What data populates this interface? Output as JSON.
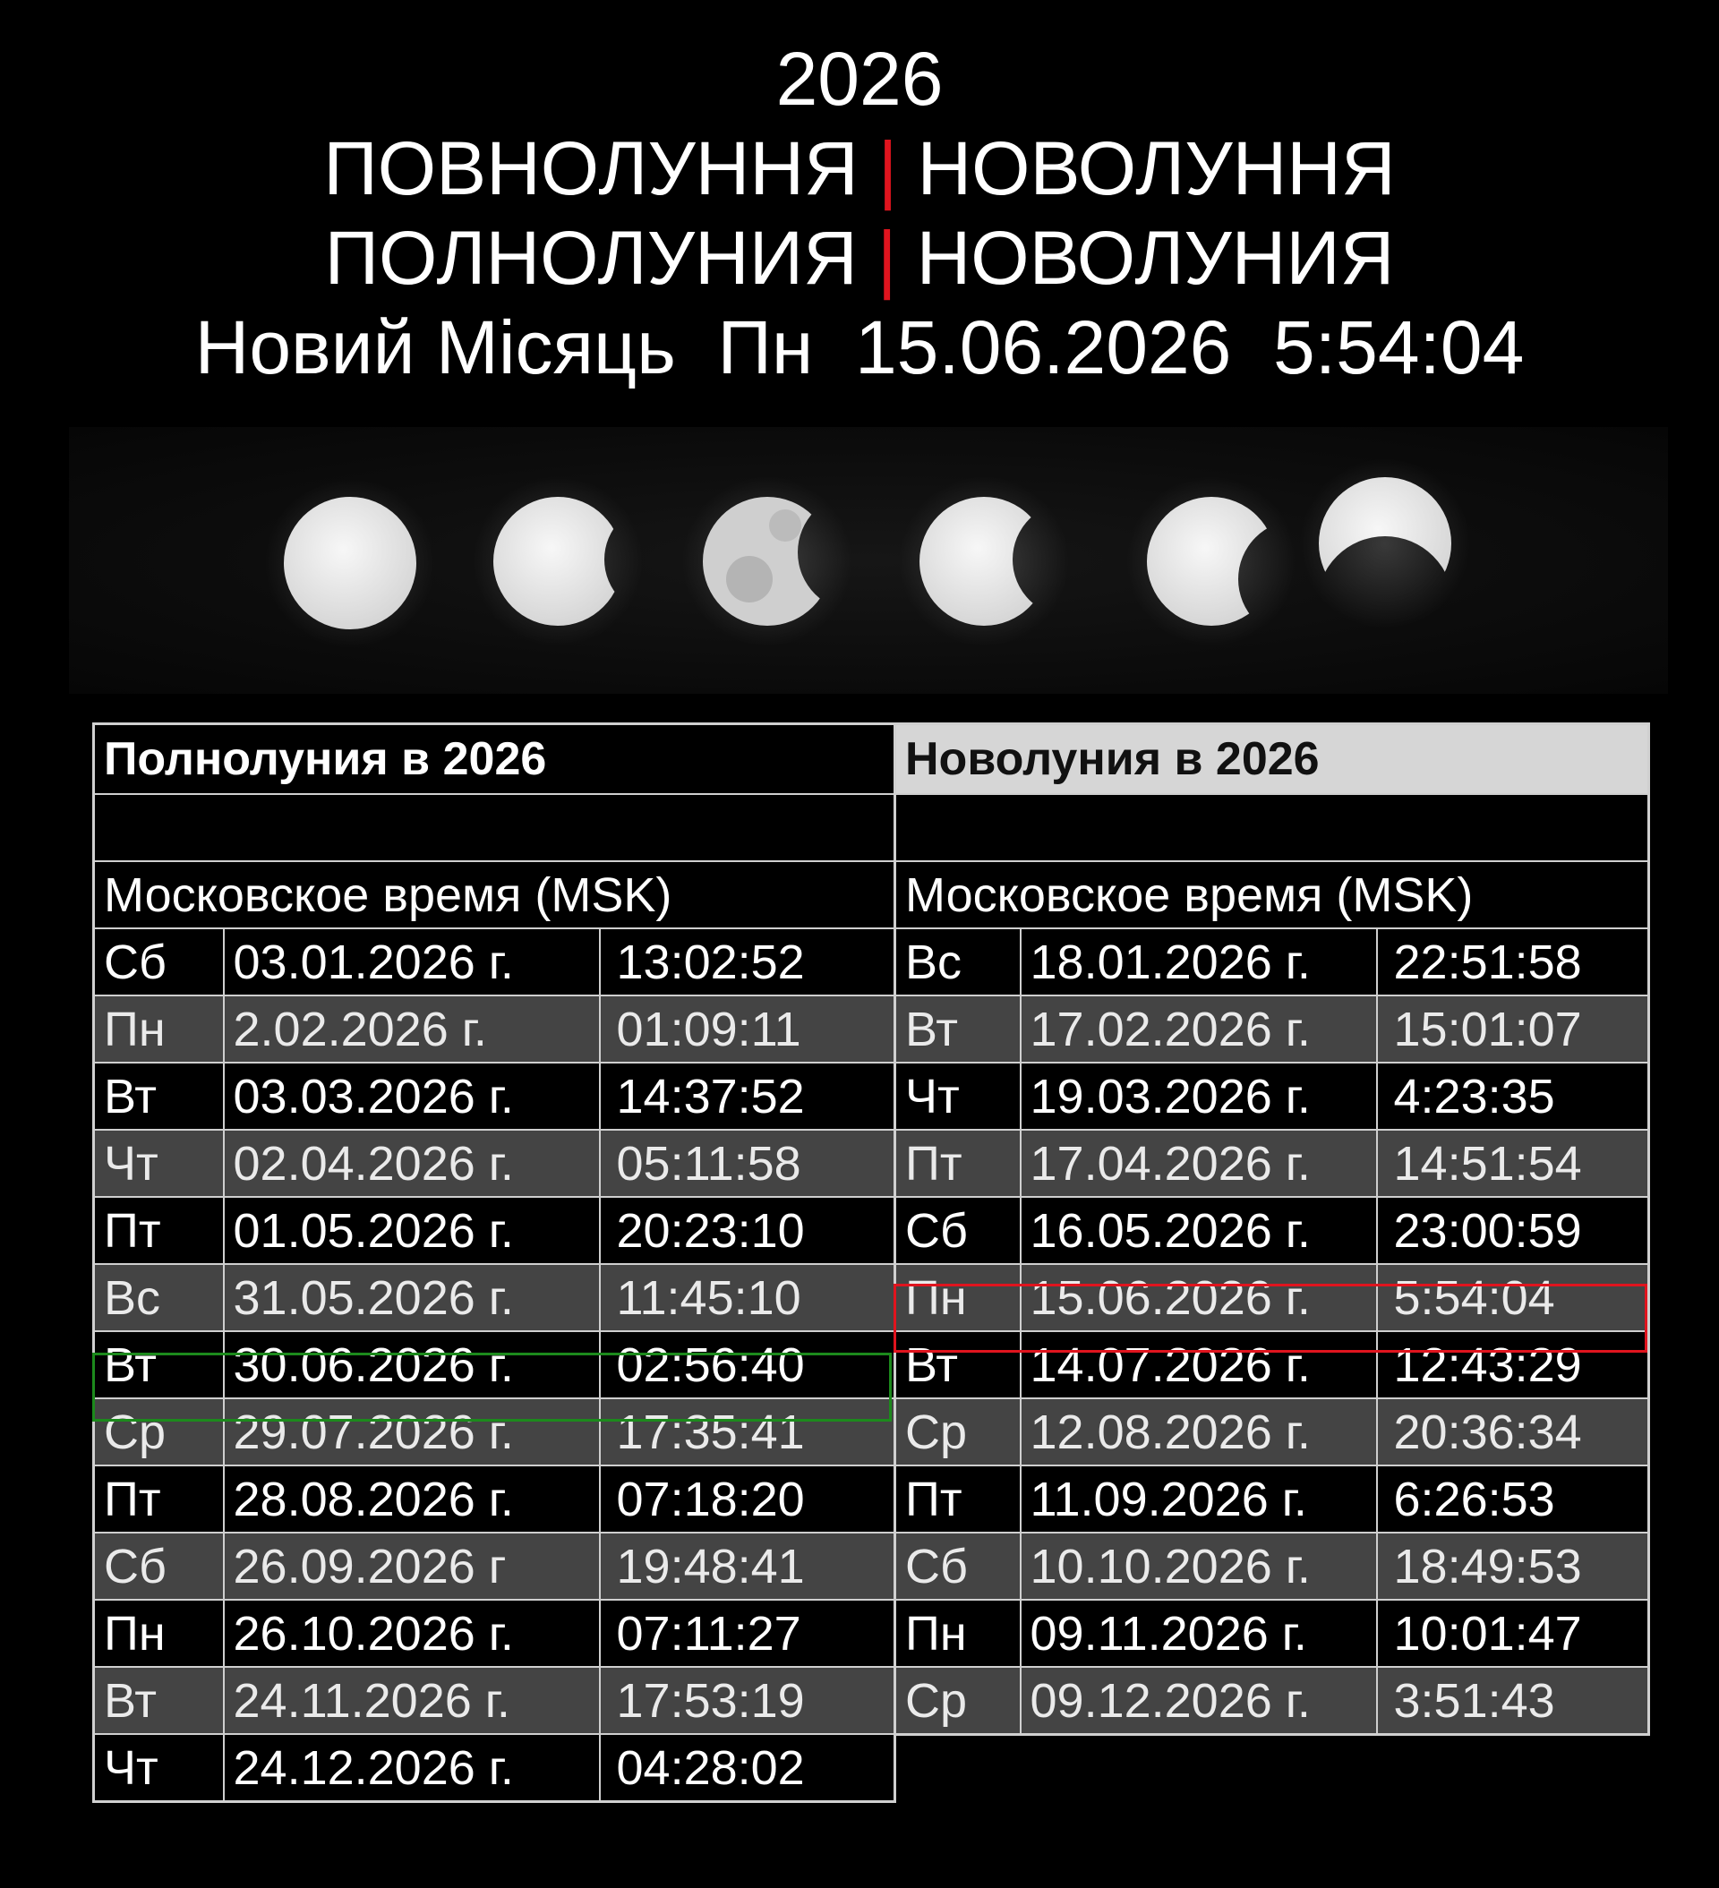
{
  "header": {
    "year": "2026",
    "line_uk_full": "ПОВНОЛУННЯ",
    "line_uk_new": "НОВОЛУННЯ",
    "line_ru_full": "ПОЛНОЛУНИЯ",
    "line_ru_new": "НОВОЛУНИЯ",
    "separator": "|",
    "event_label": "Новий Місяць  Пн  15.06.2026  5:54:04",
    "separator_color": "#e0141e"
  },
  "phases_image": {
    "icon": "moon-phases-strip",
    "count": 6
  },
  "full_moons": {
    "title": "Полнолуния в 2026",
    "blank": "",
    "timezone": "Московское время (MSK)",
    "rows": [
      [
        "Сб",
        "03.01.2026 г.",
        "13:02:52"
      ],
      [
        "Пн",
        "2.02.2026 г.",
        "01:09:11"
      ],
      [
        "Вт",
        "03.03.2026 г.",
        "14:37:52"
      ],
      [
        "Чт",
        "02.04.2026 г.",
        "05:11:58"
      ],
      [
        "Пт",
        "01.05.2026 г.",
        "20:23:10"
      ],
      [
        "Вс",
        "31.05.2026 г.",
        "11:45:10"
      ],
      [
        "Вт",
        "30.06.2026 г.",
        "02:56:40"
      ],
      [
        "Ср",
        "29.07.2026 г.",
        "17:35:41"
      ],
      [
        "Пт",
        "28.08.2026 г.",
        "07:18:20"
      ],
      [
        "Сб",
        "26.09.2026 г",
        "19:48:41"
      ],
      [
        "Пн",
        "26.10.2026 г.",
        "07:11:27"
      ],
      [
        "Вт",
        "24.11.2026 г.",
        "17:53:19"
      ],
      [
        "Чт",
        "24.12.2026 г.",
        "04:28:02"
      ]
    ],
    "highlight_color": "#1c8a1c"
  },
  "new_moons": {
    "title": "Новолуния в 2026",
    "blank": "",
    "timezone": "Московское время (MSK)",
    "rows": [
      [
        "Вс",
        "18.01.2026 г.",
        "22:51:58"
      ],
      [
        "Вт",
        "17.02.2026 г.",
        "15:01:07"
      ],
      [
        "Чт",
        "19.03.2026 г.",
        "4:23:35"
      ],
      [
        "Пт",
        "17.04.2026 г.",
        "14:51:54"
      ],
      [
        "Сб",
        "16.05.2026 г.",
        "23:00:59"
      ],
      [
        "Пн",
        "15.06.2026 г.",
        "5:54:04"
      ],
      [
        "Вт",
        "14.07.2026 г.",
        "12:43:29"
      ],
      [
        "Ср",
        "12.08.2026 г.",
        "20:36:34"
      ],
      [
        "Пт",
        "11.09.2026 г.",
        "6:26:53"
      ],
      [
        "Сб",
        "10.10.2026 г.",
        "18:49:53"
      ],
      [
        "Пн",
        "09.11.2026 г.",
        "10:01:47"
      ],
      [
        "Ср",
        "09.12.2026 г.",
        "3:51:43"
      ]
    ],
    "highlight_color": "#e0141e"
  }
}
